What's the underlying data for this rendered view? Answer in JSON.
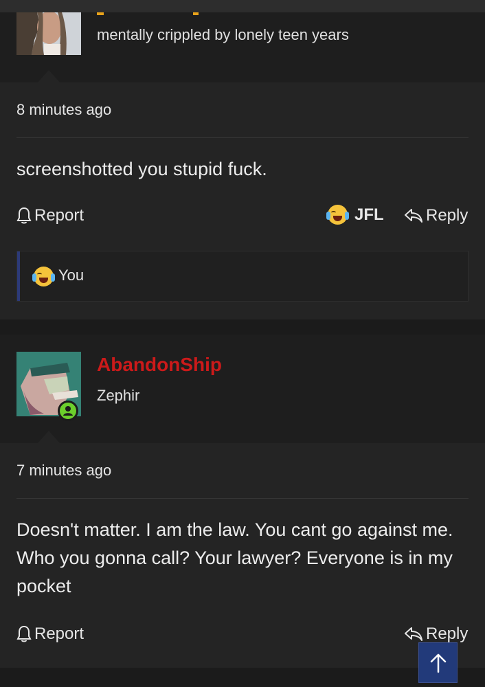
{
  "post1": {
    "user_title": "mentally crippled by lonely teen years",
    "time": "8 minutes ago",
    "content": "screenshotted you stupid fuck.",
    "report_label": "Report",
    "reaction_label": "JFL",
    "reply_label": "Reply",
    "reaction_summary": "You",
    "colors": {
      "username_partial": "#e8a21a"
    }
  },
  "post2": {
    "username": "AbandonShip",
    "user_title": "Zephir",
    "time": "7 minutes ago",
    "content": "Doesn't matter. I am the law. You cant go against me. Who you gonna call? Your lawyer? Everyone is in my pocket",
    "report_label": "Report",
    "reply_label": "Reply",
    "colors": {
      "username": "#cc1a1a",
      "online": "#6ccf2c"
    }
  },
  "icons": {
    "report": "bell-icon",
    "reply": "reply-arrow-icon",
    "reaction": "crying-laughing-emoji-icon",
    "scroll_top": "arrow-up-icon"
  }
}
